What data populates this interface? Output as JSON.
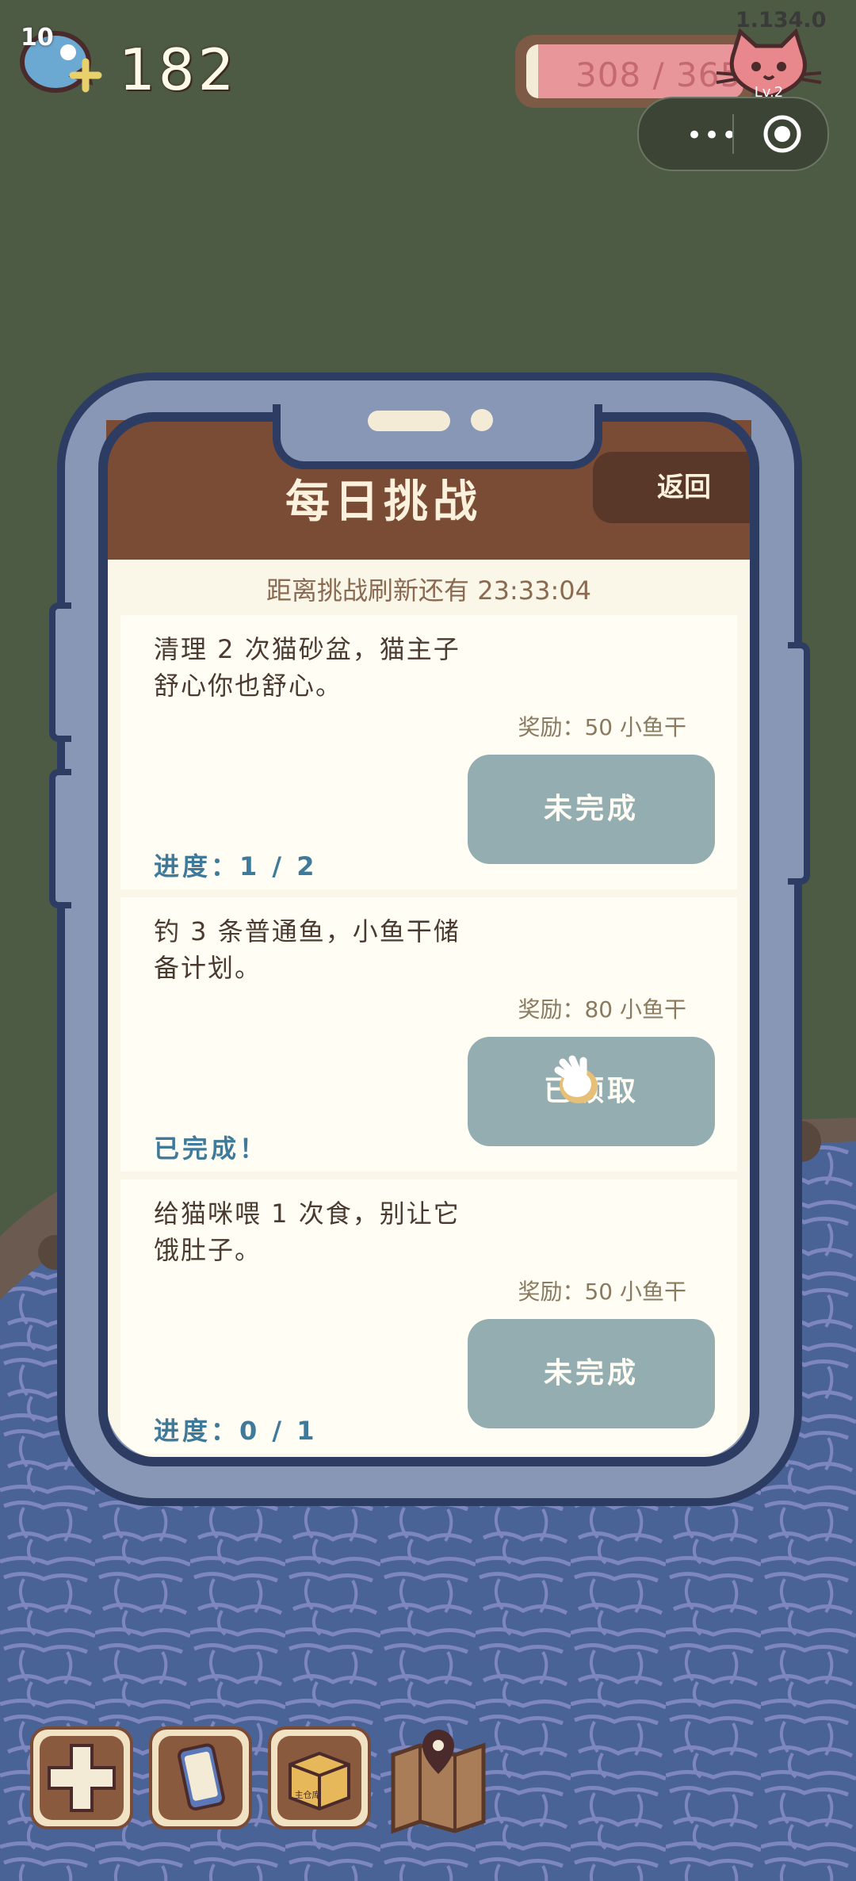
{
  "hud": {
    "fish_level": "10",
    "coins": "182",
    "version": "1.134.0",
    "hp_text": "308 / 365",
    "hp_fraction": 0.844,
    "level": "Lv.2"
  },
  "miniprogram": {
    "more_icon": "more-dots-icon",
    "close_icon": "target-icon"
  },
  "panel": {
    "title": "每日挑战",
    "back_label": "返回",
    "refresh_text": "距离挑战刷新还有 23:33:04"
  },
  "challenges": [
    {
      "desc": "清理 2 次猫砂盆，猫主子舒心你也舒心。",
      "reward": "奖励：50 小鱼干",
      "button": "未完成",
      "progress": "进度：1 / 2"
    },
    {
      "desc": "钓 3 条普通鱼，小鱼干储备计划。",
      "reward": "奖励：80 小鱼干",
      "button": "已领取",
      "progress": "已完成！"
    },
    {
      "desc": "给猫咪喂 1 次食，别让它饿肚子。",
      "reward": "奖励：50 小鱼干",
      "button": "未完成",
      "progress": "进度：0 / 1"
    }
  ],
  "toolbar": {
    "items": [
      "dpad-icon",
      "phone-icon",
      "box-icon",
      "map-icon"
    ],
    "box_label": "主仓库"
  },
  "colors": {
    "grass": "#4d5a44",
    "water": "#4a6396",
    "panel_header": "#7a4b35",
    "button": "#94adb1",
    "progress": "#3f7a9a"
  }
}
